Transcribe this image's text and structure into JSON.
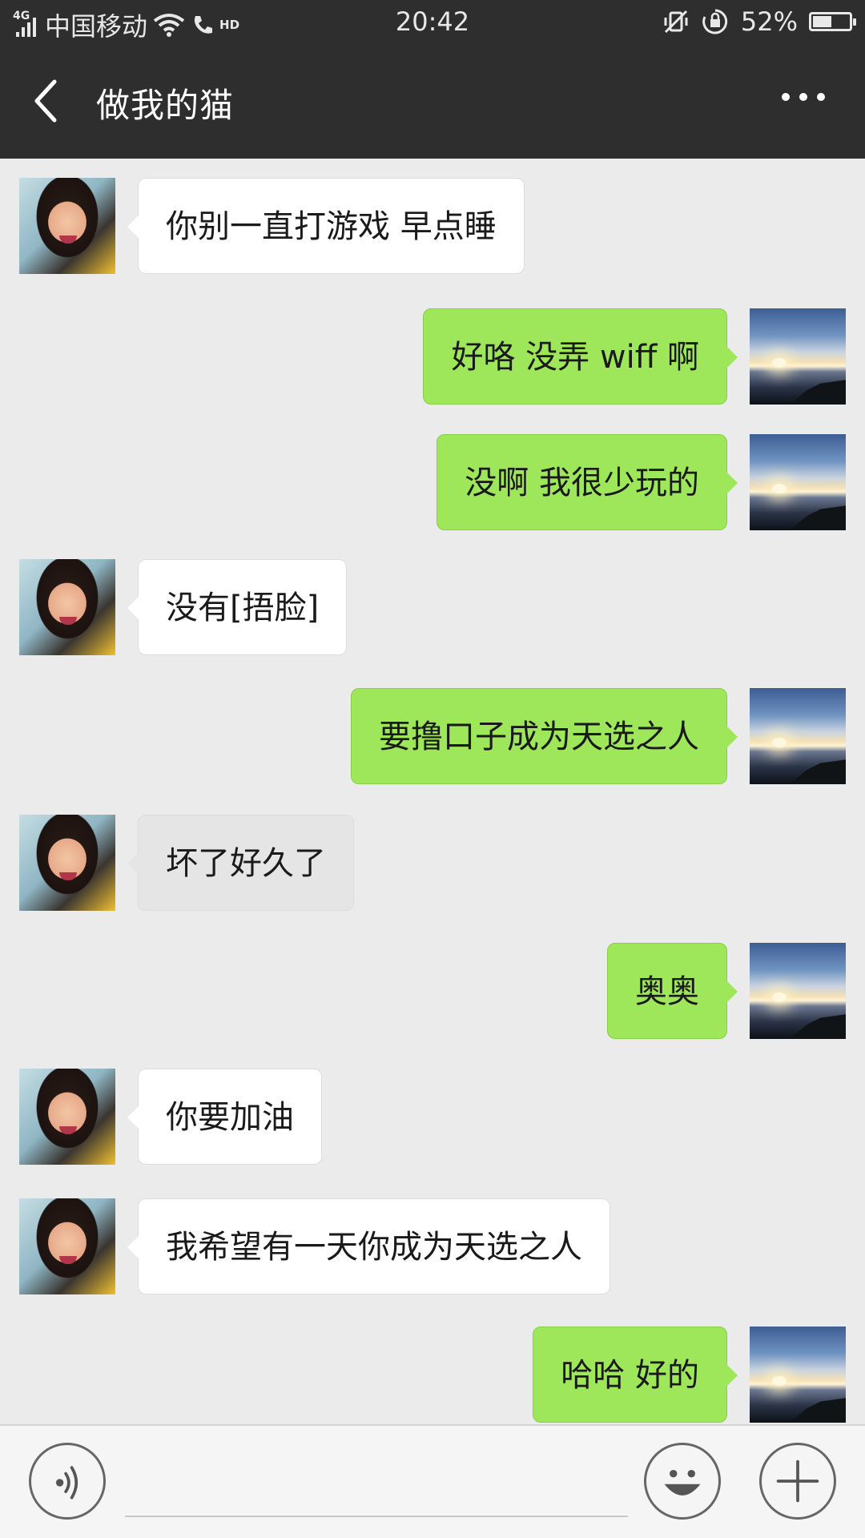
{
  "status_bar": {
    "network": "4G",
    "carrier": "中国移动",
    "hd": "HD",
    "time": "20:42",
    "battery_percent": "52%",
    "battery_level": 0.52,
    "icons": [
      "signal-icon",
      "wifi-icon",
      "call-hd-icon",
      "mute-vibrate-icon",
      "rotation-lock-icon",
      "battery-icon"
    ]
  },
  "header": {
    "title": "做我的猫",
    "back_icon": "chevron-left-icon",
    "more_icon": "more-dots-icon"
  },
  "messages": [
    {
      "side": "in",
      "text": "你别一直打游戏 早点睡"
    },
    {
      "side": "out",
      "text": "好咯  没弄 wiff 啊"
    },
    {
      "side": "out",
      "text": "没啊  我很少玩的"
    },
    {
      "side": "in",
      "text": "没有[捂脸]"
    },
    {
      "side": "out",
      "text": "要撸口子成为天选之人"
    },
    {
      "side": "in",
      "text": "坏了好久了",
      "pressed": true
    },
    {
      "side": "out",
      "text": "奥奥"
    },
    {
      "side": "in",
      "text": "你要加油"
    },
    {
      "side": "in",
      "text": "我希望有一天你成为天选之人"
    },
    {
      "side": "out",
      "text": "哈哈 好的"
    }
  ],
  "input_bar": {
    "text_value": "",
    "icons": [
      "voice-icon",
      "emoji-icon",
      "plus-icon"
    ]
  },
  "colors": {
    "header_bg": "#2e2e2e",
    "chat_bg": "#ebebeb",
    "outgoing_bubble": "#9fe75a",
    "incoming_bubble": "#ffffff"
  }
}
